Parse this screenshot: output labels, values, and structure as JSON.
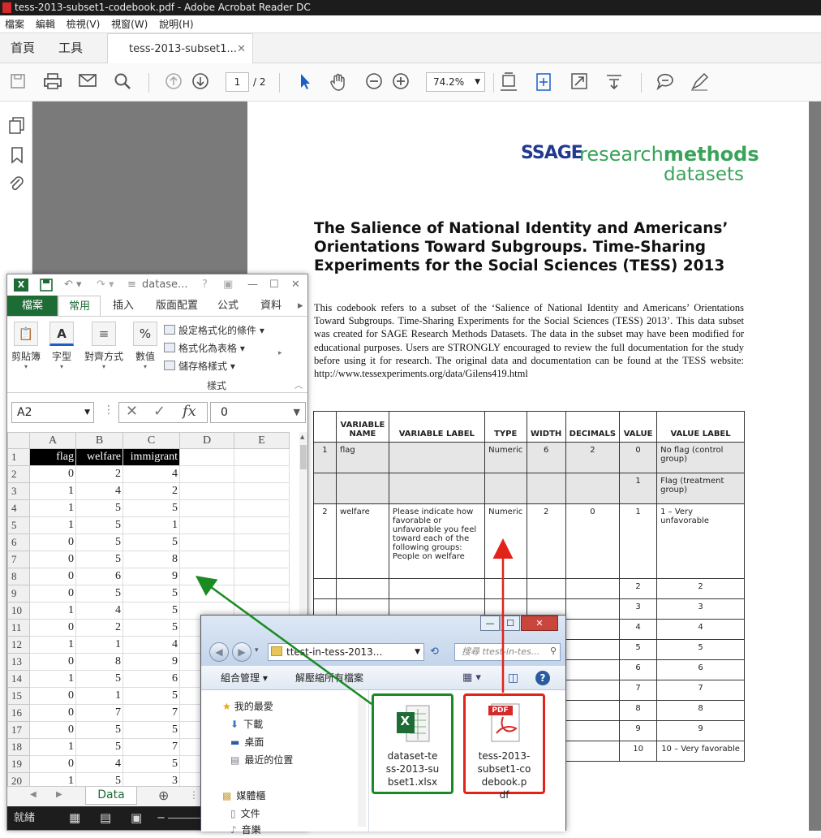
{
  "acrobat": {
    "window_title": "tess-2013-subset1-codebook.pdf - Adobe Acrobat Reader DC",
    "menu": [
      "檔案",
      "編輯",
      "檢視(V)",
      "視窗(W)",
      "說明(H)"
    ],
    "tabs": {
      "home": "首頁",
      "tools": "工具",
      "document": "tess-2013-subset1...",
      "close": "✕"
    },
    "page_current": "1",
    "page_total": "/ 2",
    "zoom": "74.2%"
  },
  "pdf": {
    "logo": {
      "sage": "SSAGE",
      "research": "research",
      "methods": "methods",
      "datasets": "datasets"
    },
    "title": "The Salience of National Identity and Americans’ Orientations Toward Subgroups. Time-Sharing Experiments for the Social Sciences (TESS) 2013",
    "body": "This codebook refers to a subset of the ‘Salience of National Identity and Americans’ Orientations Toward Subgroups. Time-Sharing Experiments for the Social Sciences (TESS) 2013’. This data subset was created for SAGE Research Methods Datasets. The data in the subset may have been modified for educational purposes. Users are STRONGLY encouraged to review the full documentation for the study before using it for research. The original data and documentation can be found at the TESS website: http://www.tessexperiments.org/data/Gilens419.html",
    "table_headers": [
      "",
      "VARIABLE NAME",
      "VARIABLE LABEL",
      "TYPE",
      "WIDTH",
      "DECIMALS",
      "VALUE",
      "VALUE LABEL"
    ],
    "table_rows": [
      [
        "1",
        "flag",
        "",
        "Numeric",
        "6",
        "2",
        "0",
        "No flag (control group)"
      ],
      [
        "",
        "",
        "",
        "",
        "",
        "",
        "1",
        "Flag (treatment group)"
      ],
      [
        "2",
        "welfare",
        "Please indicate how favorable or unfavorable you feel toward each of the following groups: People on welfare",
        "Numeric",
        "2",
        "0",
        "1",
        "1 – Very unfavorable"
      ],
      [
        "",
        "",
        "",
        "",
        "",
        "",
        "2",
        "2"
      ],
      [
        "",
        "",
        "",
        "",
        "",
        "",
        "3",
        "3"
      ],
      [
        "",
        "",
        "",
        "",
        "",
        "",
        "4",
        "4"
      ],
      [
        "",
        "",
        "",
        "",
        "",
        "",
        "5",
        "5"
      ],
      [
        "",
        "",
        "",
        "",
        "",
        "",
        "6",
        "6"
      ],
      [
        "",
        "",
        "",
        "",
        "",
        "",
        "7",
        "7"
      ],
      [
        "",
        "",
        "",
        "",
        "",
        "",
        "8",
        "8"
      ],
      [
        "",
        "",
        "",
        "",
        "",
        "",
        "9",
        "9"
      ],
      [
        "",
        "",
        "",
        "",
        "",
        "",
        "10",
        "10 – Very favorable"
      ]
    ]
  },
  "excel": {
    "title": "datase...",
    "tabs": {
      "file": "檔案",
      "home": "常用",
      "insert": "插入",
      "layout": "版面配置",
      "formula": "公式",
      "data": "資料"
    },
    "ribbon": {
      "clipboard": "剪貼簿",
      "font": "字型",
      "align": "對齊方式",
      "number": "數值",
      "cond": "設定格式化的條件",
      "table": "格式化為表格",
      "cellstyle": "儲存格樣式",
      "group": "樣式"
    },
    "namebox": "A2",
    "formula_value": "0",
    "fx": "fx",
    "columns": [
      "A",
      "B",
      "C",
      "D",
      "E"
    ],
    "headers": [
      "flag",
      "welfare",
      "immigrant"
    ],
    "rows": [
      [
        "2",
        "0",
        "2",
        "4"
      ],
      [
        "3",
        "1",
        "4",
        "2"
      ],
      [
        "4",
        "1",
        "5",
        "5"
      ],
      [
        "5",
        "1",
        "5",
        "1"
      ],
      [
        "6",
        "0",
        "5",
        "5"
      ],
      [
        "7",
        "0",
        "5",
        "8"
      ],
      [
        "8",
        "0",
        "6",
        "9"
      ],
      [
        "9",
        "0",
        "5",
        "5"
      ],
      [
        "10",
        "1",
        "4",
        "5"
      ],
      [
        "11",
        "0",
        "2",
        "5"
      ],
      [
        "12",
        "1",
        "1",
        "4"
      ],
      [
        "13",
        "0",
        "8",
        "9"
      ],
      [
        "14",
        "1",
        "5",
        "6"
      ],
      [
        "15",
        "0",
        "1",
        "5"
      ],
      [
        "16",
        "0",
        "7",
        "7"
      ],
      [
        "17",
        "0",
        "5",
        "5"
      ],
      [
        "18",
        "1",
        "5",
        "7"
      ],
      [
        "19",
        "0",
        "4",
        "5"
      ],
      [
        "20",
        "1",
        "5",
        "3"
      ]
    ],
    "sheet": "Data",
    "status": "就緒"
  },
  "explorer": {
    "path": "ttest-in-tess-2013...",
    "search": "搜尋 ttest-in-tes...",
    "organize": "組合管理 ▾",
    "unzip": "解壓縮所有檔案",
    "nav": {
      "favorites": "我的最愛",
      "downloads": "下載",
      "desktop": "桌面",
      "recent": "最近的位置",
      "libraries": "媒體櫃",
      "documents": "文件",
      "more": "音樂"
    },
    "files": {
      "xlsx": [
        "dataset-te",
        "ss-2013-su",
        "bset1.xlsx"
      ],
      "pdf": [
        "tess-2013-",
        "subset1-co",
        "debook.p",
        "df"
      ]
    },
    "pdf_badge": "PDF",
    "xl_badge": "X"
  },
  "colors": {
    "green_arrow": "#1b8a23",
    "red_arrow": "#e2231a",
    "excel_green": "#1d6b35"
  }
}
